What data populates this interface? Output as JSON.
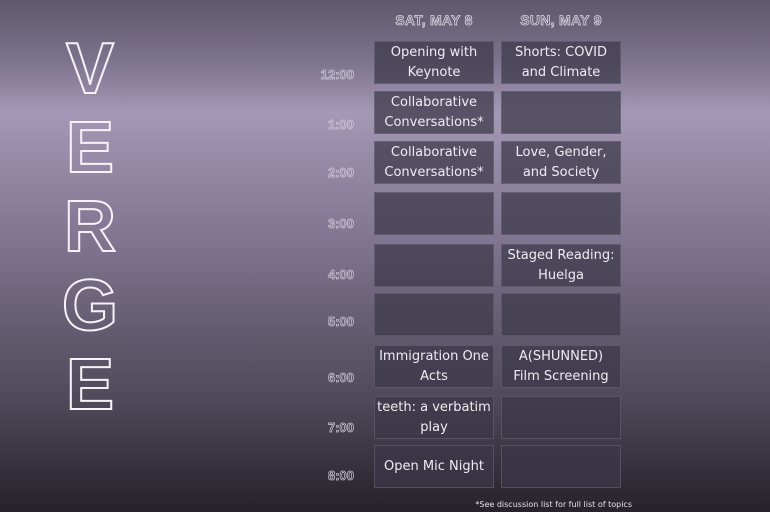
{
  "title_letters": [
    "V",
    "E",
    "R",
    "G",
    "E"
  ],
  "days": [
    "SAT, MAY 8",
    "SUN, MAY 9"
  ],
  "times": [
    "12:00",
    "1:00",
    "2:00",
    "3:00",
    "4:00",
    "5:00",
    "6:00",
    "7:00",
    "8:00"
  ],
  "schedule": {
    "sat": [
      "Opening with Keynote",
      "Collaborative Conversations*",
      "Collaborative Conversations*",
      "",
      "",
      "",
      "Immigration One Acts",
      "teeth: a verbatim play",
      "Open Mic Night"
    ],
    "sun": [
      "Shorts: COVID and Climate",
      "",
      "Love, Gender, and Society",
      "",
      "Staged Reading: Huelga",
      "",
      "A(SHUNNED) Film Screening",
      "",
      ""
    ]
  },
  "footnote": "*See discussion list for full list of  topics"
}
